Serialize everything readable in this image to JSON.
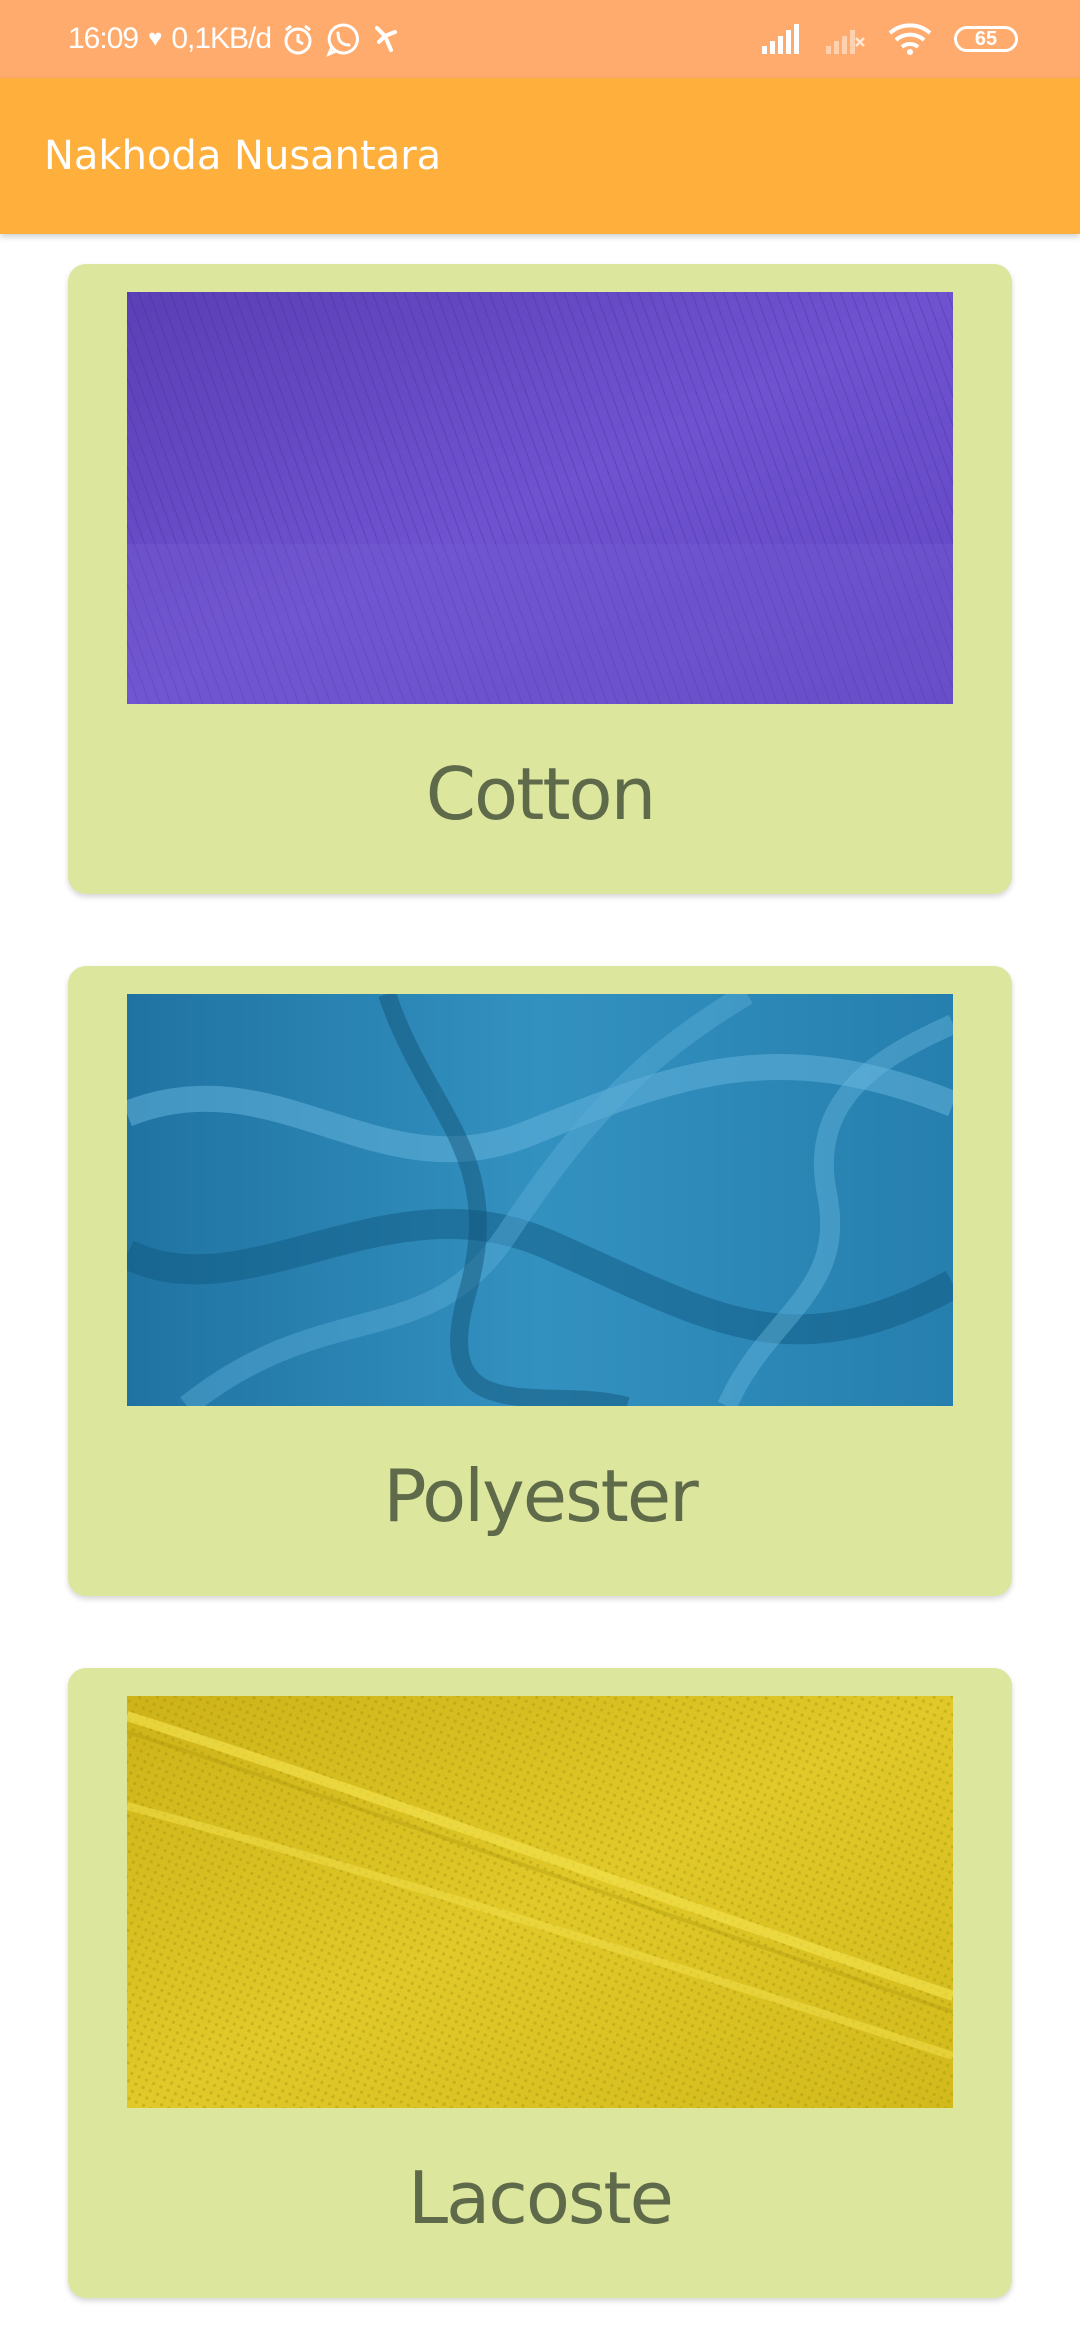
{
  "status_bar": {
    "time": "16:09",
    "heart_glyph": "♥",
    "network_speed": "0,1KB/d",
    "icons": [
      "alarm-icon",
      "whatsapp-icon",
      "app-notification-icon"
    ],
    "right_icons": [
      "signal-icon",
      "signal-no-service-icon",
      "wifi-icon"
    ],
    "battery": "65"
  },
  "app_bar": {
    "title": "Nakhoda Nusantara",
    "color": "#FFAF3B"
  },
  "colors": {
    "status_bar": "#FFAB6D",
    "card_background": "#DDE69D",
    "card_label": "#5E6A4A"
  },
  "fabrics": [
    {
      "name": "Cotton",
      "image": "purple-knit-fabric-photo",
      "color": "#6A4BC6"
    },
    {
      "name": "Polyester",
      "image": "blue-satin-fabric-photo",
      "color": "#2E86B4"
    },
    {
      "name": "Lacoste",
      "image": "yellow-pique-fabric-photo",
      "color": "#D9C21E"
    }
  ]
}
